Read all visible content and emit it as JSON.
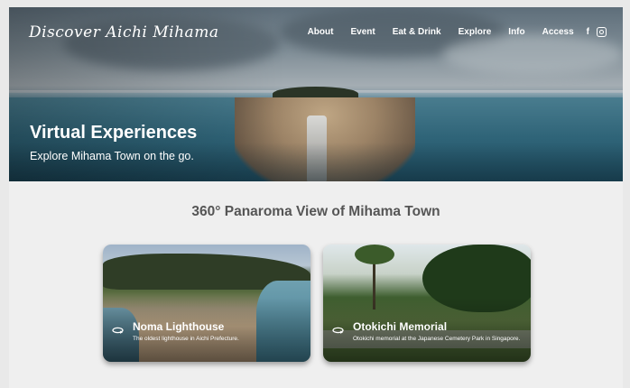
{
  "header": {
    "logo": "Discover Aichi Mihama",
    "nav": [
      "About",
      "Event",
      "Eat & Drink",
      "Explore",
      "Info",
      "Access"
    ],
    "social": {
      "facebook": "f"
    }
  },
  "hero": {
    "title": "Virtual Experiences",
    "subtitle": "Explore Mihama Town on the go."
  },
  "section": {
    "title": "360° Panaroma View of Mihama Town"
  },
  "cards": [
    {
      "title": "Noma Lighthouse",
      "description": "The oldest lighthouse in Aichi Prefecture."
    },
    {
      "title": "Otokichi Memorial",
      "description": "Otokichi memorial at the Japanese Cemetery Park in Singapore."
    }
  ],
  "colors": {
    "page_bg": "#efefef",
    "section_title": "#555555",
    "text_on_image": "#ffffff"
  }
}
